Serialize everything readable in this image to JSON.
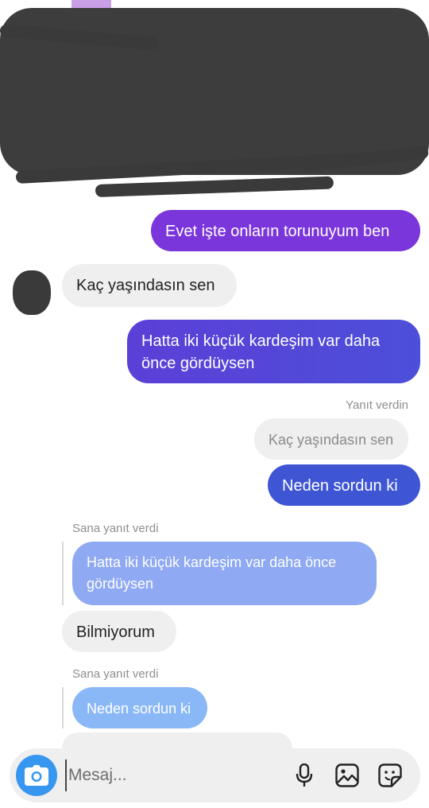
{
  "thread": {
    "messages": [
      {
        "text": "Evet işte onların torunuyum ben",
        "direction": "outgoing"
      },
      {
        "text": "Kaç yaşındasın sen",
        "direction": "incoming"
      },
      {
        "text": "Hatta iki küçük kardeşim var daha önce gördüysen",
        "direction": "outgoing"
      },
      {
        "reply_label": "Yanıt verdin",
        "quoted": "Kaç yaşındasın sen",
        "text": "Neden sordun ki",
        "direction": "outgoing"
      },
      {
        "reply_label": "Sana yanıt verdi",
        "quoted": "Hatta iki küçük kardeşim var daha önce gördüysen",
        "text": "Bilmiyorum",
        "direction": "incoming"
      },
      {
        "reply_label": "Sana yanıt verdi",
        "quoted": "Neden sordun ki",
        "text": "",
        "direction": "incoming"
      }
    ]
  },
  "composer": {
    "placeholder": "Mesaj..."
  },
  "icons": {
    "camera": "camera-icon",
    "microphone": "microphone-icon",
    "gallery": "gallery-icon",
    "sticker": "sticker-icon"
  },
  "colors": {
    "outgoing_purple": "#7a35db",
    "outgoing_indigo": "#5147d8",
    "outgoing_blue": "#3f56d4",
    "camera_blue": "#3797f0",
    "incoming_gray": "#efefef"
  }
}
